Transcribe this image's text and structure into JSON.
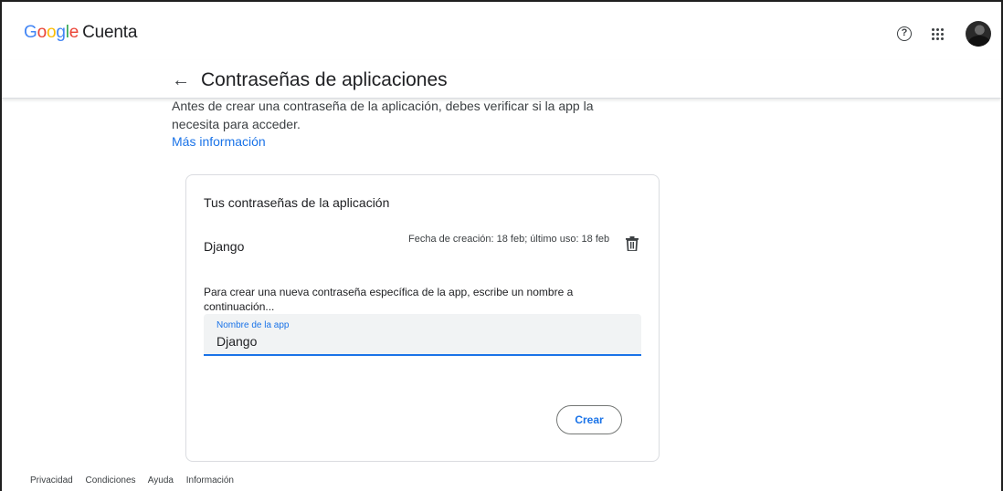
{
  "header": {
    "logo": {
      "letters": [
        "G",
        "o",
        "o",
        "g",
        "l",
        "e"
      ],
      "product": "Cuenta"
    },
    "help_icon": "help-circle-icon",
    "apps_icon": "apps-grid-icon",
    "avatar": "user-avatar"
  },
  "subheader": {
    "back_icon": "arrow-back-icon",
    "title": "Contraseñas de aplicaciones"
  },
  "intro": {
    "text": "Antes de crear una contraseña de la aplicación, debes verificar si la app la necesita para acceder.",
    "link": "Más información"
  },
  "card": {
    "title": "Tus contraseñas de la aplicación",
    "passwords": [
      {
        "name": "Django",
        "meta": "Fecha de creación: 18 feb; último uso: 18 feb",
        "delete_icon": "trash-icon"
      }
    ],
    "hint": "Para crear una nueva contraseña específica de la app, escribe un nombre a continuación...",
    "field": {
      "label": "Nombre de la app",
      "value": "Django"
    },
    "create_button": "Crear"
  },
  "footer": {
    "links": [
      "Privacidad",
      "Condiciones",
      "Ayuda",
      "Información"
    ]
  },
  "colors": {
    "accent": "#1a73e8",
    "text": "#202124",
    "border": "#dadce0",
    "field_bg": "#f1f3f4"
  }
}
